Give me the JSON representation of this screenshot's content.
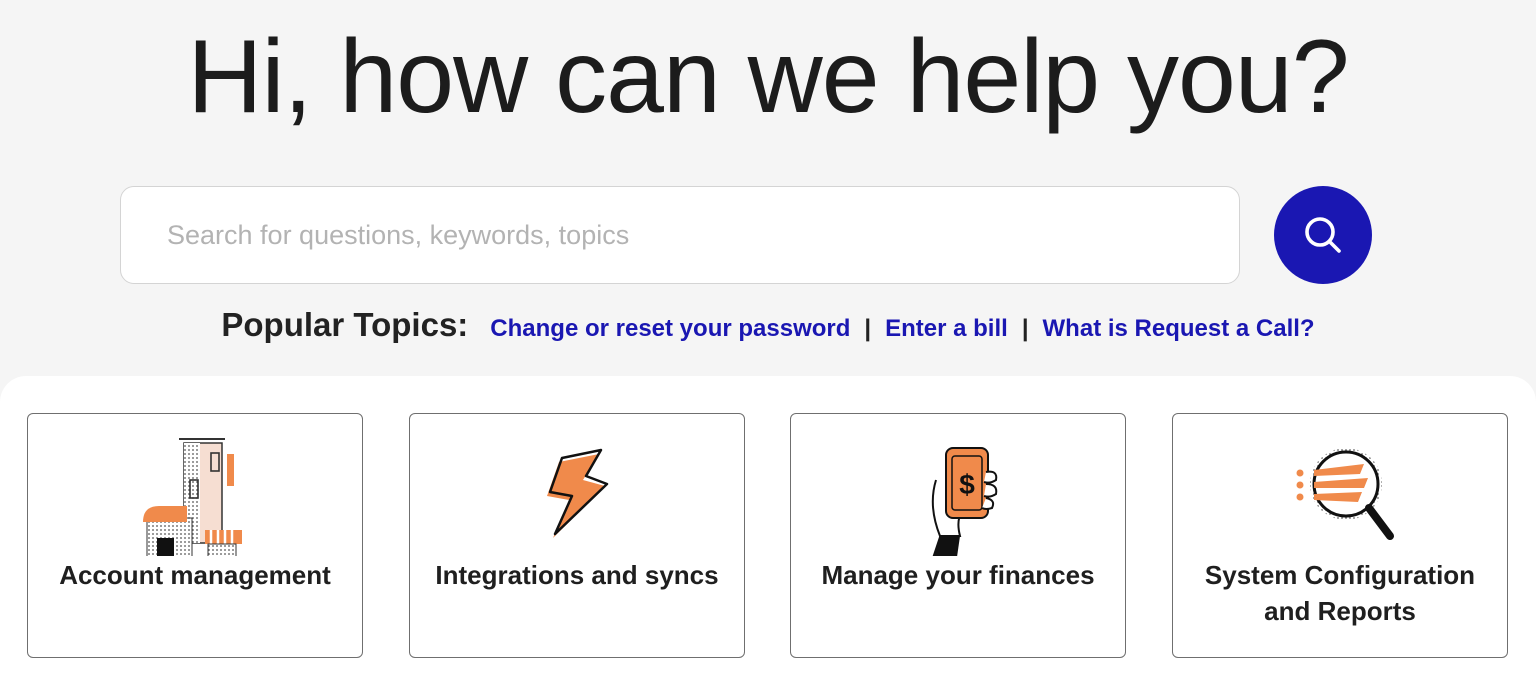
{
  "hero": {
    "title": "Hi, how can we help you?"
  },
  "search": {
    "placeholder": "Search for questions, keywords, topics",
    "button_icon": "search-icon",
    "button_color": "#1a17b2"
  },
  "popular": {
    "label": "Popular Topics:",
    "links": [
      {
        "label": "Change or reset your password"
      },
      {
        "label": "Enter a bill"
      },
      {
        "label": "What is Request a Call?"
      }
    ],
    "separator": "|"
  },
  "categories": [
    {
      "label": "Account management",
      "icon": "building-icon"
    },
    {
      "label": "Integrations and syncs",
      "icon": "lightning-icon"
    },
    {
      "label": "Manage your finances",
      "icon": "phone-dollar-icon"
    },
    {
      "label": "System Configuration and Reports",
      "icon": "magnifier-report-icon"
    }
  ],
  "colors": {
    "accent": "#1a17b2",
    "illustration": "#f08a4b"
  }
}
